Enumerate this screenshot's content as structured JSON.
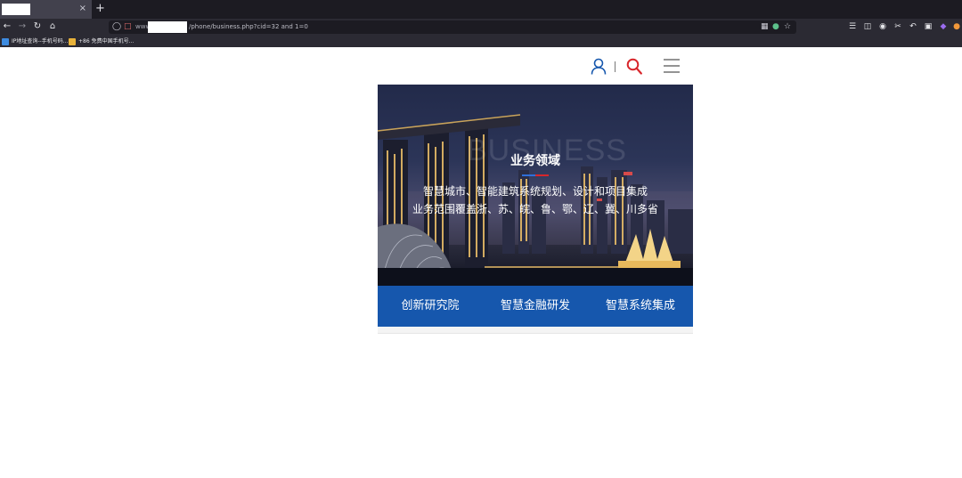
{
  "browser": {
    "tab_close": "×",
    "new_tab": "+",
    "url_prefix": "www.",
    "url_path": "/phone/business.php?cid=32 and 1=0",
    "bookmarks": [
      {
        "label": "IP地址查询--手机号码...",
        "icon_color": "#3d8be0"
      },
      {
        "label": "+86 免费中国手机号...",
        "icon_color": "#e8b23a"
      }
    ]
  },
  "header": {
    "user_icon": "user-icon",
    "search_icon": "search-icon",
    "menu_icon": "menu-icon",
    "colors": {
      "user": "#1657ad",
      "search": "#d8262b",
      "menu": "#555555"
    }
  },
  "banner": {
    "watermark": "BUSINESS",
    "title": "业务领域",
    "line1": "智慧城市、智能建筑系统规划、设计和项目集成",
    "line2": "业务范围覆盖浙、苏、皖、鲁、鄂、辽、冀、川多省",
    "underline_colors": [
      "#2f6fd8",
      "#d8262b"
    ]
  },
  "tabs": [
    {
      "label": "创新研究院"
    },
    {
      "label": "智慧金融研发"
    },
    {
      "label": "智慧系统集成"
    }
  ],
  "colors": {
    "tab_bar": "#1657ad"
  }
}
